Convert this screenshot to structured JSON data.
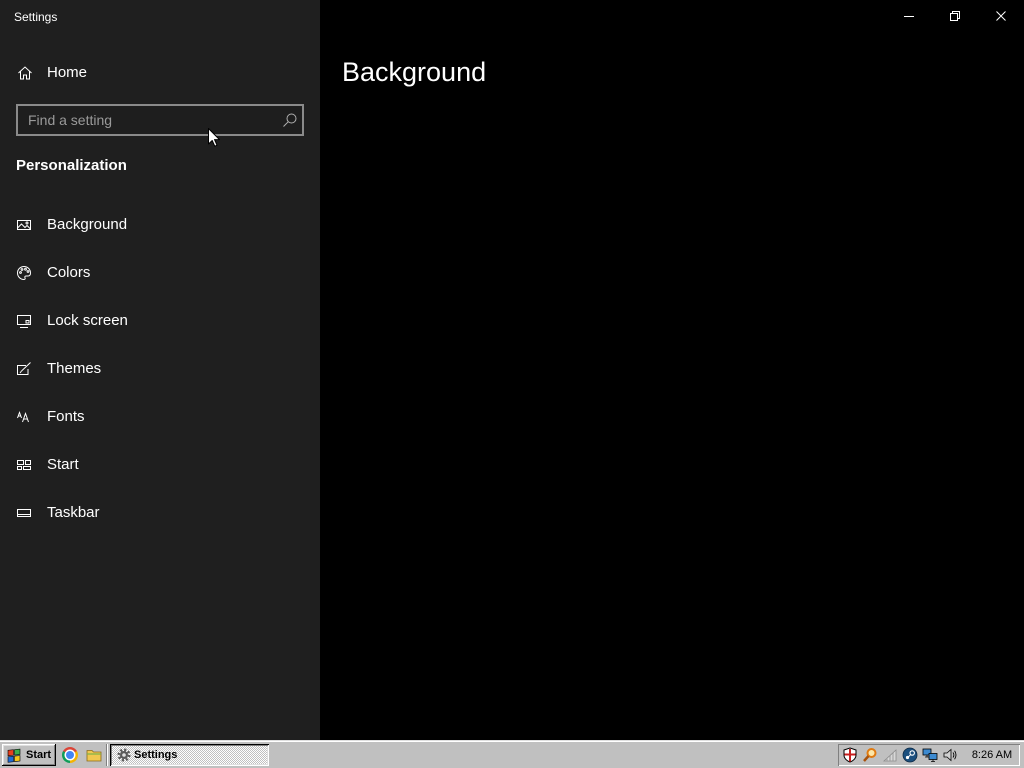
{
  "window": {
    "title": "Settings",
    "controls": {
      "minimize_icon": "minimize-icon",
      "restore_icon": "restore-icon",
      "close_icon": "close-icon"
    }
  },
  "sidebar": {
    "home": {
      "label": "Home",
      "icon": "home-icon"
    },
    "search": {
      "placeholder": "Find a setting",
      "icon": "search-icon"
    },
    "section_title": "Personalization",
    "items": [
      {
        "label": "Background",
        "icon": "picture-icon"
      },
      {
        "label": "Colors",
        "icon": "palette-icon"
      },
      {
        "label": "Lock screen",
        "icon": "lock-screen-icon"
      },
      {
        "label": "Themes",
        "icon": "themes-icon"
      },
      {
        "label": "Fonts",
        "icon": "fonts-icon"
      },
      {
        "label": "Start",
        "icon": "start-tiles-icon"
      },
      {
        "label": "Taskbar",
        "icon": "taskbar-icon"
      }
    ]
  },
  "main": {
    "page_title": "Background"
  },
  "taskbar": {
    "start": {
      "label": "Start",
      "icon": "windows-flag-icon"
    },
    "quick_launch": [
      {
        "icon": "chrome-icon"
      },
      {
        "icon": "folder-icon"
      }
    ],
    "tasks": [
      {
        "label": "Settings",
        "icon": "gear-icon",
        "active": true
      }
    ],
    "tray": {
      "icons": [
        "security-shield-icon",
        "search-tool-icon",
        "wireless-signal-icon",
        "steam-icon",
        "network-icon",
        "volume-icon"
      ],
      "clock": "8:26 AM"
    }
  },
  "colors": {
    "sidebar_bg": "#1f1f1f",
    "main_bg": "#000000",
    "text": "#ffffff",
    "placeholder": "#9a9a9a",
    "search_border": "#8a8a8a",
    "taskbar_bg": "#c0c0c0"
  }
}
